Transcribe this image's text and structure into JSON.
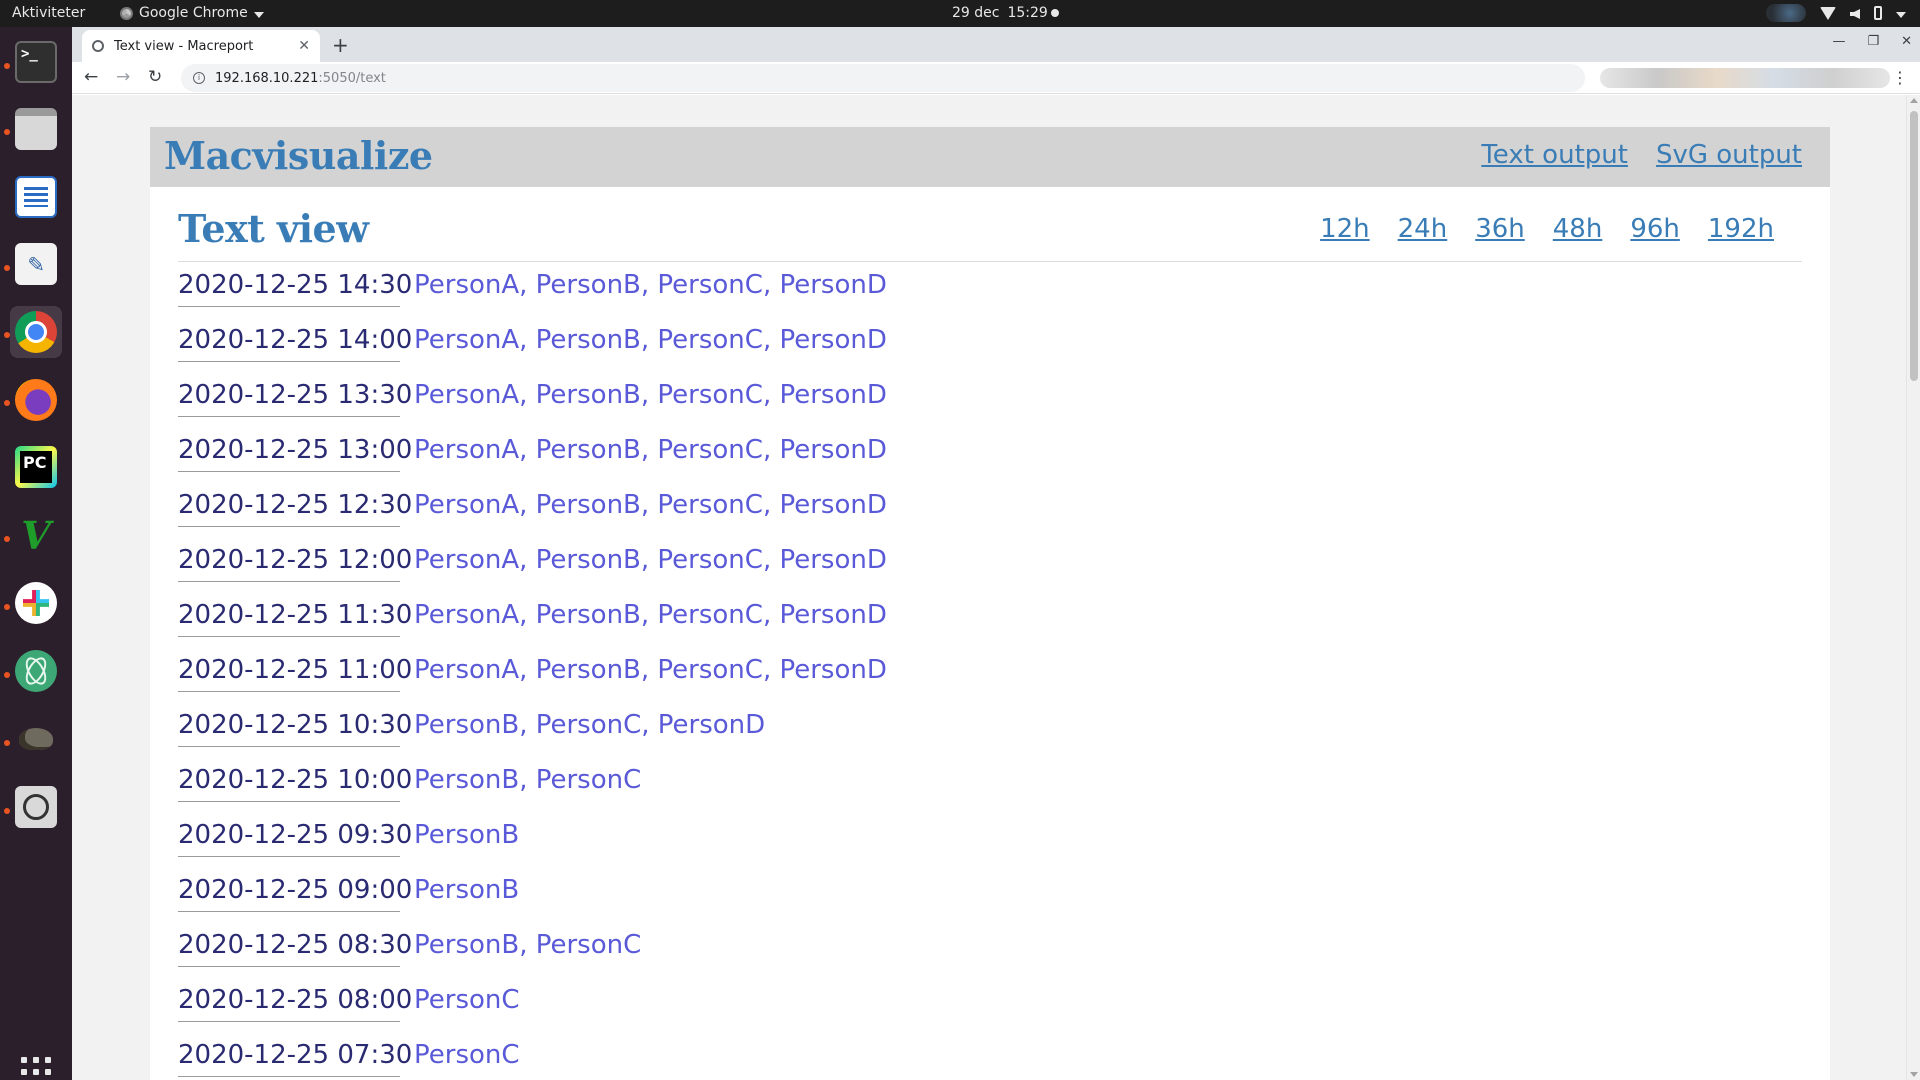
{
  "system_bar": {
    "activities": "Aktiviteter",
    "app_name": "Google Chrome",
    "date": "29 dec",
    "time": "15:29"
  },
  "browser": {
    "tab_title": "Text view - Macreport",
    "url_host": "192.168.10.221",
    "url_path": ":5050/text"
  },
  "site": {
    "brand": "Macvisualize",
    "nav": [
      "Text output",
      "SvG output"
    ]
  },
  "page": {
    "title": "Text view",
    "ranges": [
      "12h",
      "24h",
      "36h",
      "48h",
      "96h",
      "192h"
    ]
  },
  "entries": [
    {
      "time": "2020-12-25 14:30",
      "people": "PersonA, PersonB, PersonC, PersonD"
    },
    {
      "time": "2020-12-25 14:00",
      "people": "PersonA, PersonB, PersonC, PersonD"
    },
    {
      "time": "2020-12-25 13:30",
      "people": "PersonA, PersonB, PersonC, PersonD"
    },
    {
      "time": "2020-12-25 13:00",
      "people": "PersonA, PersonB, PersonC, PersonD"
    },
    {
      "time": "2020-12-25 12:30",
      "people": "PersonA, PersonB, PersonC, PersonD"
    },
    {
      "time": "2020-12-25 12:00",
      "people": "PersonA, PersonB, PersonC, PersonD"
    },
    {
      "time": "2020-12-25 11:30",
      "people": "PersonA, PersonB, PersonC, PersonD"
    },
    {
      "time": "2020-12-25 11:00",
      "people": "PersonA, PersonB, PersonC, PersonD"
    },
    {
      "time": "2020-12-25 10:30",
      "people": "PersonB, PersonC, PersonD"
    },
    {
      "time": "2020-12-25 10:00",
      "people": "PersonB, PersonC"
    },
    {
      "time": "2020-12-25 09:30",
      "people": "PersonB"
    },
    {
      "time": "2020-12-25 09:00",
      "people": "PersonB"
    },
    {
      "time": "2020-12-25 08:30",
      "people": "PersonB, PersonC"
    },
    {
      "time": "2020-12-25 08:00",
      "people": "PersonC"
    },
    {
      "time": "2020-12-25 07:30",
      "people": "PersonC"
    }
  ],
  "colors": {
    "heading": "#3a7db6",
    "timestamp": "#2a2a72",
    "people": "#5a5ad8",
    "header_bg": "#d3d3d3"
  },
  "dock_icons": [
    "terminal-icon",
    "files-icon",
    "writer-icon",
    "text-editor-icon",
    "chrome-icon",
    "firefox-icon",
    "pycharm-icon",
    "vim-icon",
    "slack-icon",
    "atom-icon",
    "gimp-icon",
    "search-tool-icon",
    "show-apps-icon"
  ]
}
